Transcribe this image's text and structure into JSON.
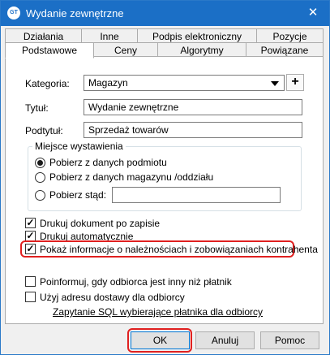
{
  "window": {
    "title": "Wydanie zewnętrzne",
    "icon_text": "GT",
    "close_glyph": "✕"
  },
  "tabs_row1": [
    "Działania",
    "Inne",
    "Podpis elektroniczny",
    "Pozycje"
  ],
  "tabs_row2": [
    "Podstawowe",
    "Ceny",
    "Algorytmy",
    "Powiązane"
  ],
  "active_tab": "Podstawowe",
  "form": {
    "kategoria_label": "Kategoria:",
    "kategoria_value": "Magazyn",
    "plus_glyph": "+",
    "tytul_label": "Tytuł:",
    "tytul_value": "Wydanie zewnętrzne",
    "podtytul_label": "Podtytuł:",
    "podtytul_value": "Sprzedaż towarów"
  },
  "miejsce": {
    "title": "Miejsce wystawienia",
    "options": [
      "Pobierz z danych podmiotu",
      "Pobierz z danych magazynu /oddziału",
      "Pobierz stąd:"
    ],
    "selected_index": 0,
    "custom_value": ""
  },
  "checkboxes": [
    {
      "label": "Drukuj dokument po zapisie",
      "checked": true
    },
    {
      "label": "Drukuj automatycznie",
      "checked": true
    },
    {
      "label": "Pokaż informacje o należnościach i zobowiązaniach kontrahenta",
      "checked": true
    }
  ],
  "checkboxes2": [
    {
      "label": "Poinformuj, gdy odbiorca jest inny niż płatnik",
      "checked": false
    },
    {
      "label": "Użyj adresu dostawy dla odbiorcy",
      "checked": false
    }
  ],
  "sql_link": "Zapytanie SQL wybierające płatnika dla odbiorcy",
  "check_glyph": "✓",
  "highlight_color": "#e02020",
  "buttons": {
    "ok": "OK",
    "cancel": "Anuluj",
    "help": "Pomoc"
  }
}
